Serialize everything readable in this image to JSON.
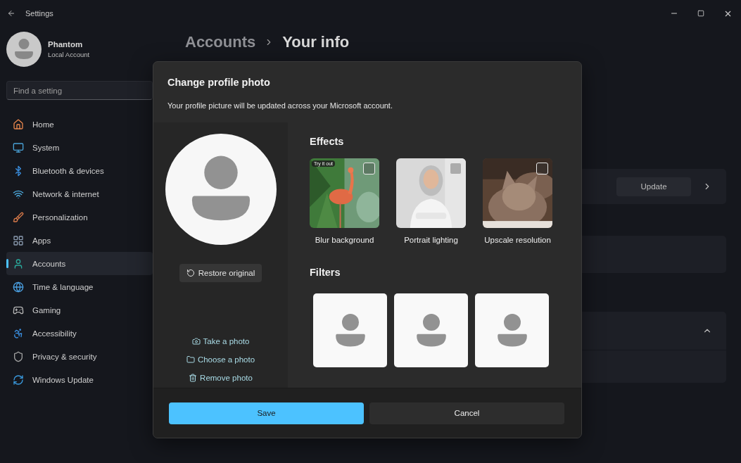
{
  "window": {
    "title": "Settings"
  },
  "profile": {
    "name": "Phantom",
    "account_type": "Local Account"
  },
  "search": {
    "placeholder": "Find a setting"
  },
  "sidebar": {
    "items": [
      {
        "label": "Home",
        "selected": false
      },
      {
        "label": "System",
        "selected": false
      },
      {
        "label": "Bluetooth & devices",
        "selected": false
      },
      {
        "label": "Network & internet",
        "selected": false
      },
      {
        "label": "Personalization",
        "selected": false
      },
      {
        "label": "Apps",
        "selected": false
      },
      {
        "label": "Accounts",
        "selected": true
      },
      {
        "label": "Time & language",
        "selected": false
      },
      {
        "label": "Gaming",
        "selected": false
      },
      {
        "label": "Accessibility",
        "selected": false
      },
      {
        "label": "Privacy & security",
        "selected": false
      },
      {
        "label": "Windows Update",
        "selected": false
      }
    ]
  },
  "breadcrumb": [
    "Accounts",
    "Your info"
  ],
  "cards": [
    {
      "kind": "action",
      "button": "Update"
    },
    {
      "kind": "plain"
    },
    {
      "kind": "expander",
      "expanded": true
    },
    {
      "kind": "sub"
    }
  ],
  "dialog": {
    "title": "Change profile photo",
    "subtitle": "Your profile picture will be updated across your Microsoft account.",
    "restore": "Restore original",
    "links": [
      {
        "kind": "camera",
        "label": "Take a photo"
      },
      {
        "kind": "folder",
        "label": "Choose a photo"
      },
      {
        "kind": "trash",
        "label": "Remove photo"
      }
    ],
    "effects_heading": "Effects",
    "effects": [
      {
        "label": "Blur background",
        "checked": false,
        "badge": "Try it out",
        "kind": "picture"
      },
      {
        "label": "Portrait lighting",
        "checked": false,
        "kind": "picture"
      },
      {
        "label": "Upscale resolution",
        "checked": false,
        "kind": "picture"
      }
    ],
    "filters_heading": "Filters",
    "filters": [
      {
        "kind": "avatar"
      },
      {
        "kind": "avatar"
      },
      {
        "kind": "avatar"
      }
    ],
    "buttons": [
      {
        "label": "Save",
        "kind": "primary"
      },
      {
        "label": "Cancel",
        "kind": "secondary"
      }
    ]
  }
}
